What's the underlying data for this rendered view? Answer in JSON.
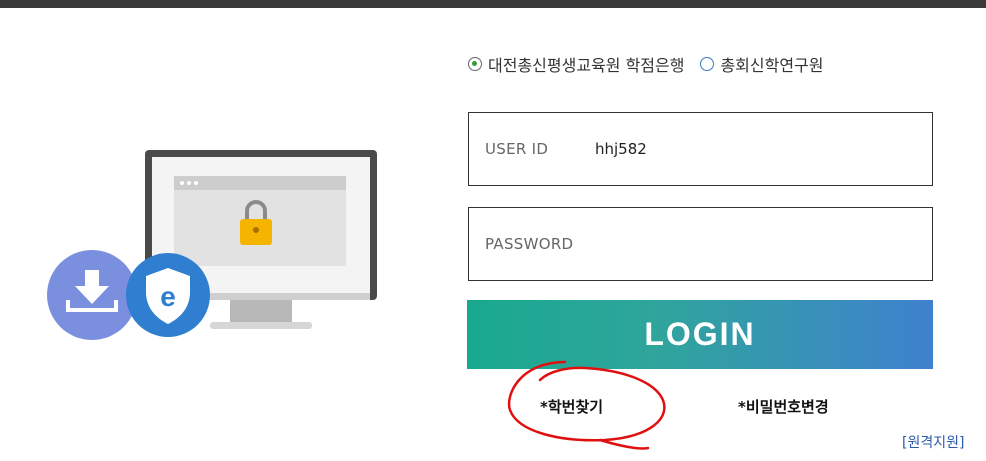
{
  "org_options": [
    {
      "label": "대전총신평생교육원 학점은행",
      "selected": true
    },
    {
      "label": "총회신학연구원",
      "selected": false
    }
  ],
  "user_id": {
    "label": "USER ID",
    "value": "hhj582"
  },
  "password": {
    "label": "PASSWORD",
    "value": ""
  },
  "login_button": "LOGIN",
  "links": {
    "find_student_id": "*학번찾기",
    "change_password": "*비밀번호변경",
    "remote_support": "[원격지원]"
  },
  "illustration": {
    "monitor_icon": "locked-monitor-icon",
    "download_icon": "download-icon",
    "shield_icon": "e-shield-icon",
    "ie_letter": "e"
  },
  "colors": {
    "login_gradient_start": "#19a98f",
    "login_gradient_end": "#3f81cf",
    "annotation_circle": "#e01010",
    "radio_selected": "#3a9a3a",
    "remote_link": "#2c5aa8"
  }
}
